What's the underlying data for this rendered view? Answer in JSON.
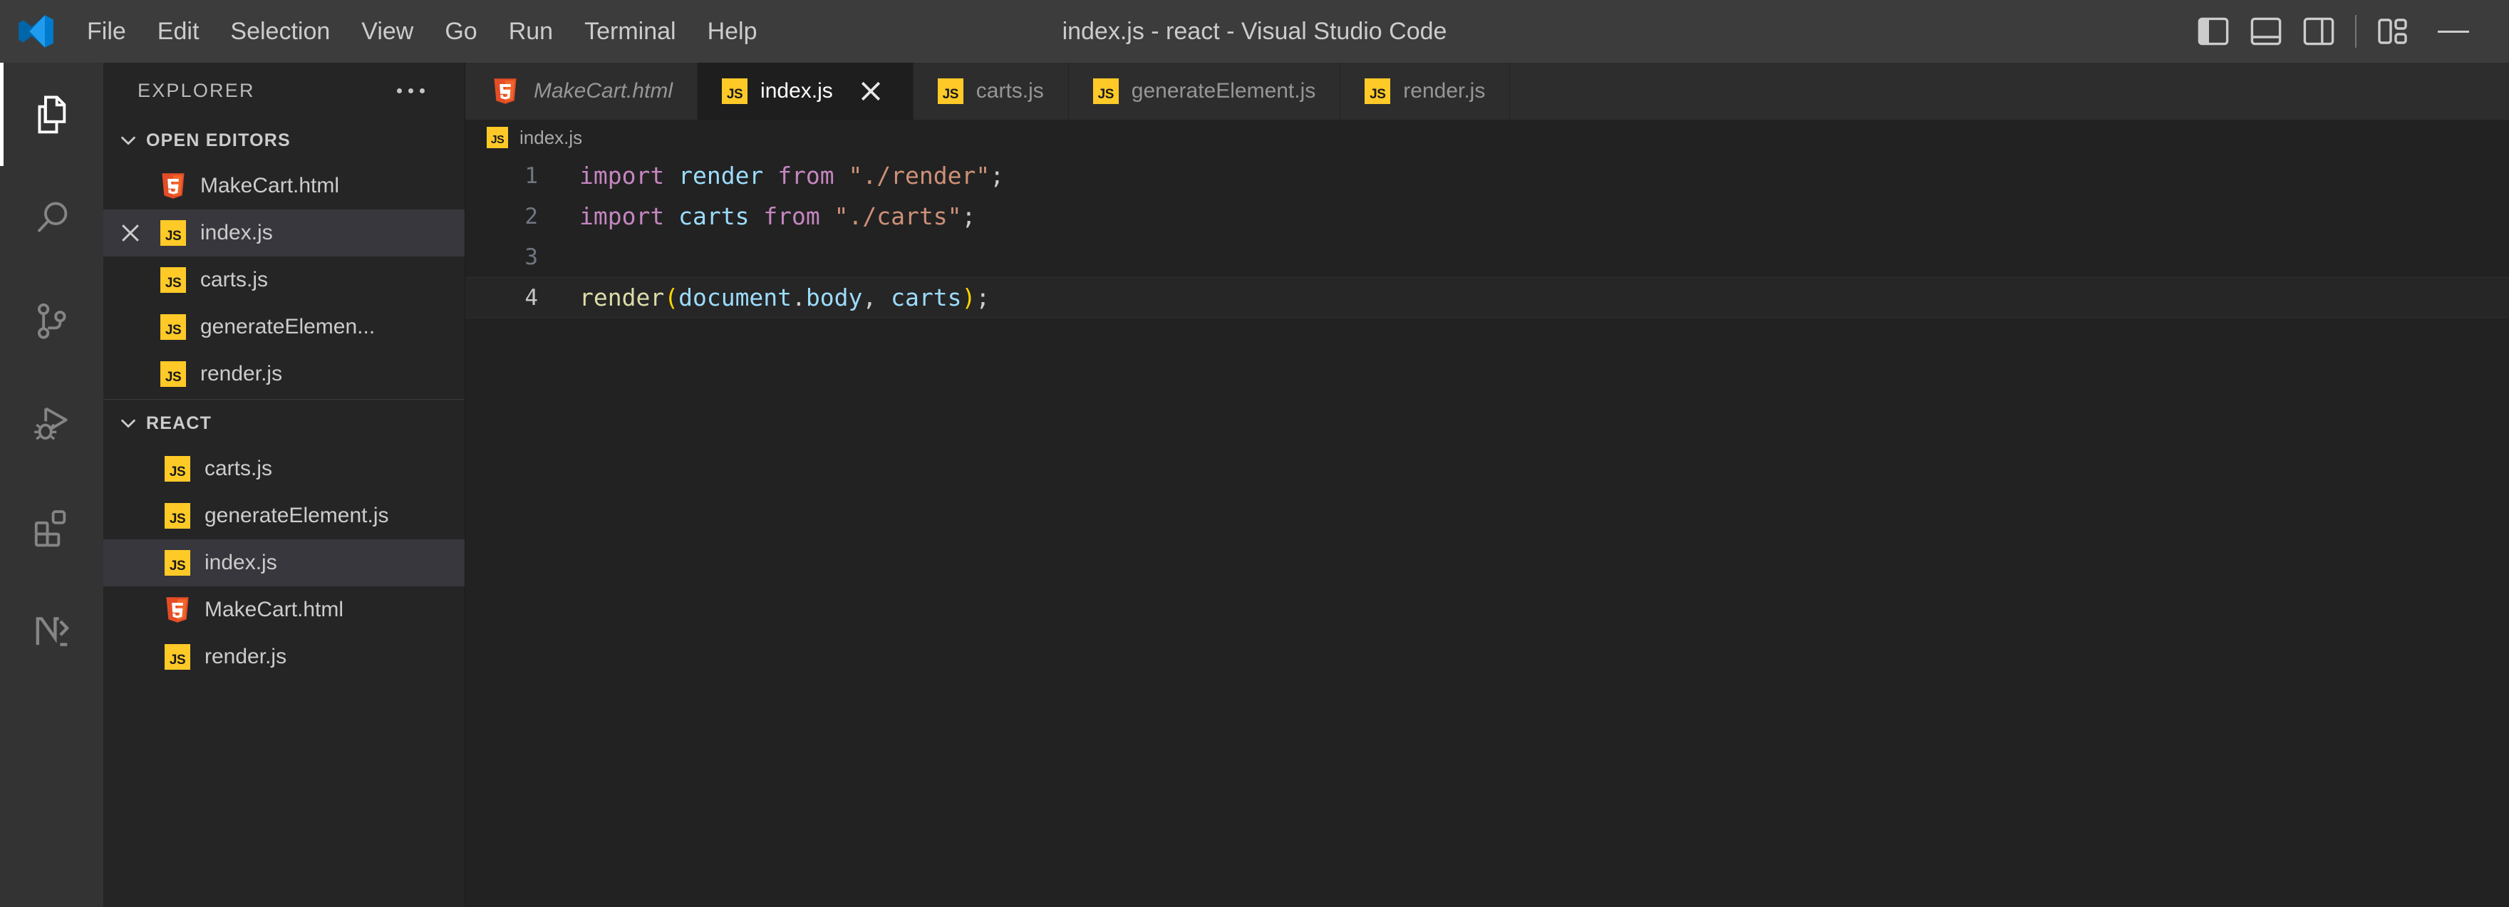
{
  "window": {
    "title": "index.js - react - Visual Studio Code",
    "logo_icon": "vscode-logo-icon",
    "accent": "#0078d4",
    "titlebar_bg": "#3c3c3c",
    "editor_bg": "#222222",
    "sidebar_bg": "#252526",
    "activitybar_bg": "#333333"
  },
  "menubar": {
    "items": [
      {
        "label": "File"
      },
      {
        "label": "Edit"
      },
      {
        "label": "Selection"
      },
      {
        "label": "View"
      },
      {
        "label": "Go"
      },
      {
        "label": "Run"
      },
      {
        "label": "Terminal"
      },
      {
        "label": "Help"
      }
    ]
  },
  "titlebar_controls": [
    {
      "name": "toggle-primary-sidebar-button",
      "icon": "layout-sidebar-left-icon"
    },
    {
      "name": "toggle-panel-button",
      "icon": "layout-panel-bottom-icon"
    },
    {
      "name": "toggle-secondary-sidebar-button",
      "icon": "layout-sidebar-right-icon"
    },
    {
      "name": "customize-layout-button",
      "icon": "layout-customize-icon"
    },
    {
      "name": "minimize-window-button",
      "icon": "minimize-icon"
    }
  ],
  "activitybar": {
    "items": [
      {
        "label": "Explorer",
        "icon": "files-icon",
        "active": true
      },
      {
        "label": "Search",
        "icon": "search-icon",
        "active": false
      },
      {
        "label": "Source Control",
        "icon": "source-control-icon",
        "active": false
      },
      {
        "label": "Run and Debug",
        "icon": "run-debug-icon",
        "active": false
      },
      {
        "label": "Extensions",
        "icon": "extensions-icon",
        "active": false
      },
      {
        "label": "Node Dependencies",
        "icon": "npm-n-icon",
        "active": false
      }
    ]
  },
  "sidebar": {
    "title": "EXPLORER",
    "more_actions_icon": "ellipsis-icon",
    "sections": [
      {
        "label": "OPEN EDITORS",
        "collapse_icon": "chevron-down-icon",
        "expanded": true,
        "items": [
          {
            "label": "MakeCart.html",
            "icon": "html5-file-icon",
            "selected": false,
            "closable": false
          },
          {
            "label": "index.js",
            "icon": "js-file-icon",
            "selected": true,
            "closable": true,
            "close_icon": "close-icon"
          },
          {
            "label": "carts.js",
            "icon": "js-file-icon",
            "selected": false,
            "closable": false
          },
          {
            "label": "generateElemen...",
            "icon": "js-file-icon",
            "selected": false,
            "closable": false
          },
          {
            "label": "render.js",
            "icon": "js-file-icon",
            "selected": false,
            "closable": false
          }
        ]
      },
      {
        "label": "REACT",
        "collapse_icon": "chevron-down-icon",
        "expanded": true,
        "items": [
          {
            "label": "carts.js",
            "icon": "js-file-icon",
            "selected": false
          },
          {
            "label": "generateElement.js",
            "icon": "js-file-icon",
            "selected": false
          },
          {
            "label": "index.js",
            "icon": "js-file-icon",
            "selected": true
          },
          {
            "label": "MakeCart.html",
            "icon": "html5-file-icon",
            "selected": false
          },
          {
            "label": "render.js",
            "icon": "js-file-icon",
            "selected": false
          }
        ]
      }
    ]
  },
  "editor": {
    "tabs": [
      {
        "label": "MakeCart.html",
        "icon": "html5-file-icon",
        "active": false,
        "closable": false
      },
      {
        "label": "index.js",
        "icon": "js-file-icon",
        "active": true,
        "closable": true,
        "close_icon": "close-icon"
      },
      {
        "label": "carts.js",
        "icon": "js-file-icon",
        "active": false,
        "closable": false
      },
      {
        "label": "generateElement.js",
        "icon": "js-file-icon",
        "active": false,
        "closable": false
      },
      {
        "label": "render.js",
        "icon": "js-file-icon",
        "active": false,
        "closable": false
      }
    ],
    "breadcrumb": {
      "icon": "js-file-icon",
      "path": "index.js"
    },
    "code": {
      "language": "javascript",
      "current_line": 4,
      "lines": [
        {
          "number": "1",
          "text": "import render from \"./render\";",
          "tokens": [
            {
              "t": "import",
              "c": "kw"
            },
            {
              "t": " ",
              "c": "punc"
            },
            {
              "t": "render",
              "c": "var"
            },
            {
              "t": " ",
              "c": "punc"
            },
            {
              "t": "from",
              "c": "kw"
            },
            {
              "t": " ",
              "c": "punc"
            },
            {
              "t": "\"./render\"",
              "c": "str"
            },
            {
              "t": ";",
              "c": "punc"
            }
          ]
        },
        {
          "number": "2",
          "text": "import carts from \"./carts\";",
          "tokens": [
            {
              "t": "import",
              "c": "kw"
            },
            {
              "t": " ",
              "c": "punc"
            },
            {
              "t": "carts",
              "c": "var"
            },
            {
              "t": " ",
              "c": "punc"
            },
            {
              "t": "from",
              "c": "kw"
            },
            {
              "t": " ",
              "c": "punc"
            },
            {
              "t": "\"./carts\"",
              "c": "str"
            },
            {
              "t": ";",
              "c": "punc"
            }
          ]
        },
        {
          "number": "3",
          "text": "",
          "tokens": []
        },
        {
          "number": "4",
          "text": "render(document.body, carts);",
          "tokens": [
            {
              "t": "render",
              "c": "fn"
            },
            {
              "t": "(",
              "c": "paren"
            },
            {
              "t": "document",
              "c": "var"
            },
            {
              "t": ".",
              "c": "punc"
            },
            {
              "t": "body",
              "c": "var"
            },
            {
              "t": ",",
              "c": "punc"
            },
            {
              "t": " ",
              "c": "punc"
            },
            {
              "t": "carts",
              "c": "var"
            },
            {
              "t": ")",
              "c": "paren"
            },
            {
              "t": ";",
              "c": "punc"
            }
          ]
        }
      ]
    }
  }
}
